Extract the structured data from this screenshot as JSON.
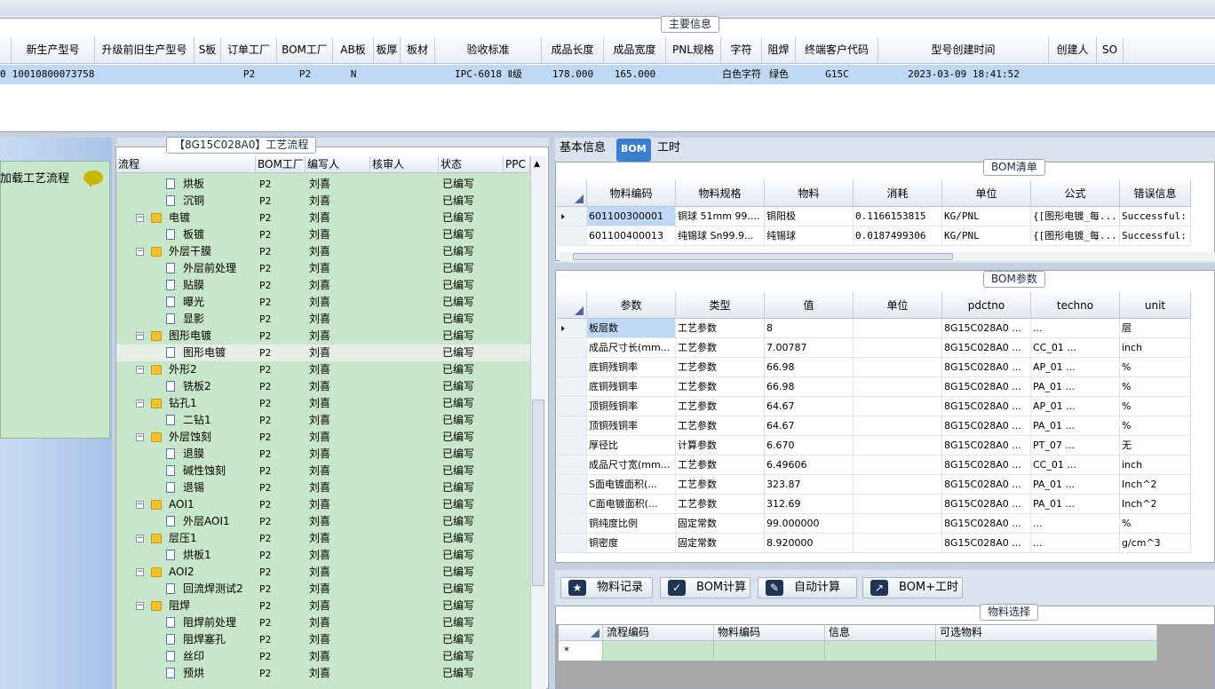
{
  "main_info": {
    "group_title": "主要信息",
    "columns": [
      "新生产型号",
      "升级前旧生产型号",
      "S板",
      "订单工厂",
      "BOM工厂",
      "AB板",
      "板厚",
      "板材",
      "验收标准",
      "成品长度",
      "成品宽度",
      "PNL规格",
      "字符",
      "阻焊",
      "终端客户代码",
      "型号创建时间",
      "创建人",
      "SO"
    ],
    "row": {
      "lead": "0",
      "model": "10010800073758",
      "s_board": "P2",
      "order_factory": "P2",
      "bom_factory": "N",
      "standard": "IPC-6018 Ⅱ级",
      "length": "178.000",
      "width": "165.000",
      "char": "白色字符",
      "solder": "绿色",
      "customer": "G15C",
      "created": "2023-03-09 18:41:52"
    }
  },
  "left": {
    "load_flow": "加载工艺流程"
  },
  "flow": {
    "group_title": "【8G15C028A0】工艺流程",
    "columns": [
      "流程",
      "BOM工厂",
      "编写人",
      "核审人",
      "状态",
      "PPC"
    ],
    "rows": [
      {
        "name": "烘板",
        "level": 2,
        "factory": "P2",
        "writer": "刘喜",
        "status": "已编写"
      },
      {
        "name": "沉铜",
        "level": 2,
        "factory": "P2",
        "writer": "刘喜",
        "status": "已编写"
      },
      {
        "name": "电镀",
        "level": 1,
        "factory": "P2",
        "writer": "刘喜",
        "status": "已编写"
      },
      {
        "name": "板镀",
        "level": 2,
        "factory": "P2",
        "writer": "刘喜",
        "status": "已编写"
      },
      {
        "name": "外层干膜",
        "level": 1,
        "factory": "P2",
        "writer": "刘喜",
        "status": "已编写"
      },
      {
        "name": "外层前处理",
        "level": 2,
        "factory": "P2",
        "writer": "刘喜",
        "status": "已编写"
      },
      {
        "name": "贴膜",
        "level": 2,
        "factory": "P2",
        "writer": "刘喜",
        "status": "已编写"
      },
      {
        "name": "曝光",
        "level": 2,
        "factory": "P2",
        "writer": "刘喜",
        "status": "已编写"
      },
      {
        "name": "显影",
        "level": 2,
        "factory": "P2",
        "writer": "刘喜",
        "status": "已编写"
      },
      {
        "name": "图形电镀",
        "level": 1,
        "factory": "P2",
        "writer": "刘喜",
        "status": "已编写"
      },
      {
        "name": "图形电镀",
        "level": 2,
        "factory": "P2",
        "writer": "刘喜",
        "status": "已编写",
        "selected": true
      },
      {
        "name": "外形2",
        "level": 1,
        "factory": "P2",
        "writer": "刘喜",
        "status": "已编写"
      },
      {
        "name": "铣板2",
        "level": 2,
        "factory": "P2",
        "writer": "刘喜",
        "status": "已编写"
      },
      {
        "name": "钻孔1",
        "level": 1,
        "factory": "P2",
        "writer": "刘喜",
        "status": "已编写"
      },
      {
        "name": "二钻1",
        "level": 2,
        "factory": "P2",
        "writer": "刘喜",
        "status": "已编写"
      },
      {
        "name": "外层蚀刻",
        "level": 1,
        "factory": "P2",
        "writer": "刘喜",
        "status": "已编写"
      },
      {
        "name": "退膜",
        "level": 2,
        "factory": "P2",
        "writer": "刘喜",
        "status": "已编写"
      },
      {
        "name": "碱性蚀刻",
        "level": 2,
        "factory": "P2",
        "writer": "刘喜",
        "status": "已编写"
      },
      {
        "name": "退锡",
        "level": 2,
        "factory": "P2",
        "writer": "刘喜",
        "status": "已编写"
      },
      {
        "name": "AOI1",
        "level": 1,
        "factory": "P2",
        "writer": "刘喜",
        "status": "已编写"
      },
      {
        "name": "外层AOI1",
        "level": 2,
        "factory": "P2",
        "writer": "刘喜",
        "status": "已编写"
      },
      {
        "name": "层压1",
        "level": 1,
        "factory": "P2",
        "writer": "刘喜",
        "status": "已编写"
      },
      {
        "name": "烘板1",
        "level": 2,
        "factory": "P2",
        "writer": "刘喜",
        "status": "已编写"
      },
      {
        "name": "AOI2",
        "level": 1,
        "factory": "P2",
        "writer": "刘喜",
        "status": "已编写"
      },
      {
        "name": "回流焊测试2",
        "level": 2,
        "factory": "P2",
        "writer": "刘喜",
        "status": "已编写"
      },
      {
        "name": "阻焊",
        "level": 1,
        "factory": "P2",
        "writer": "刘喜",
        "status": "已编写"
      },
      {
        "name": "阻焊前处理",
        "level": 2,
        "factory": "P2",
        "writer": "刘喜",
        "status": "已编写"
      },
      {
        "name": "阻焊塞孔",
        "level": 2,
        "factory": "P2",
        "writer": "刘喜",
        "status": "已编写"
      },
      {
        "name": "丝印",
        "level": 2,
        "factory": "P2",
        "writer": "刘喜",
        "status": "已编写"
      },
      {
        "name": "预烘",
        "level": 2,
        "factory": "P2",
        "writer": "刘喜",
        "status": "已编写"
      }
    ]
  },
  "tabs": [
    "基本信息",
    "BOM",
    "工时"
  ],
  "bom": {
    "group_title": "BOM清单",
    "columns": [
      "物料编码",
      "物料规格",
      "物料",
      "消耗",
      "单位",
      "公式",
      "错误信息"
    ],
    "rows": [
      [
        "601100300001",
        "铜球 51mm 99....",
        "铜阳极",
        "0.1166153815",
        "KG/PNL",
        "{[图形电镀_每...",
        "Successful: (..."
      ],
      [
        "601100400013",
        "纯锡球 Sn99.9...",
        "纯锡球",
        "0.0187499306",
        "KG/PNL",
        "{[图形电镀_每...",
        "Successful: (..."
      ]
    ]
  },
  "params": {
    "group_title": "BOM参数",
    "columns": [
      "参数",
      "类型",
      "值",
      "单位",
      "pdctno",
      "techno",
      "unit"
    ],
    "rows": [
      [
        "板层数",
        "工艺参数",
        "8",
        "",
        "8G15C028A0   ...",
        "         ...",
        "层"
      ],
      [
        "成品尺寸长(mm...",
        "工艺参数",
        "7.00787",
        "",
        "8G15C028A0   ...",
        "CC_01    ...",
        "inch"
      ],
      [
        "底铜残铜率",
        "工艺参数",
        "66.98",
        "",
        "8G15C028A0   ...",
        "AP_01    ...",
        "%"
      ],
      [
        "底铜残铜率",
        "工艺参数",
        "66.98",
        "",
        "8G15C028A0   ...",
        "PA_01    ...",
        "%"
      ],
      [
        "顶铜残铜率",
        "工艺参数",
        "64.67",
        "",
        "8G15C028A0   ...",
        "AP_01    ...",
        "%"
      ],
      [
        "顶铜残铜率",
        "工艺参数",
        "64.67",
        "",
        "8G15C028A0   ...",
        "PA_01    ...",
        "%"
      ],
      [
        "厚径比",
        "计算参数",
        "6.670",
        "",
        "8G15C028A0   ...",
        "PT_07    ...",
        "无"
      ],
      [
        "成品尺寸宽(mm...",
        "工艺参数",
        "6.49606",
        "",
        "8G15C028A0   ...",
        "CC_01    ...",
        "inch"
      ],
      [
        "S面电镀面积(...",
        "工艺参数",
        "323.87",
        "",
        "8G15C028A0   ...",
        "PA_01    ...",
        "Inch^2"
      ],
      [
        "C面电镀面积(...",
        "工艺参数",
        "312.69",
        "",
        "8G15C028A0   ...",
        "PA_01    ...",
        "Inch^2"
      ],
      [
        "铜纯度比例",
        "固定常数",
        "99.000000",
        "",
        "8G15C028A0   ...",
        "         ...",
        "%"
      ],
      [
        "铜密度",
        "固定常数",
        "8.920000",
        "",
        "8G15C028A0   ...",
        "         ...",
        "g/cm^3"
      ]
    ]
  },
  "buttons": {
    "material_record": "物料记录",
    "bom_calc": "BOM计算",
    "auto_calc": "自动计算",
    "bom_hours": "BOM+工时"
  },
  "material": {
    "group_title": "物料选择",
    "columns": [
      "流程编码",
      "物料编码",
      "信息",
      "可选物料"
    ],
    "new_row_marker": "*"
  }
}
